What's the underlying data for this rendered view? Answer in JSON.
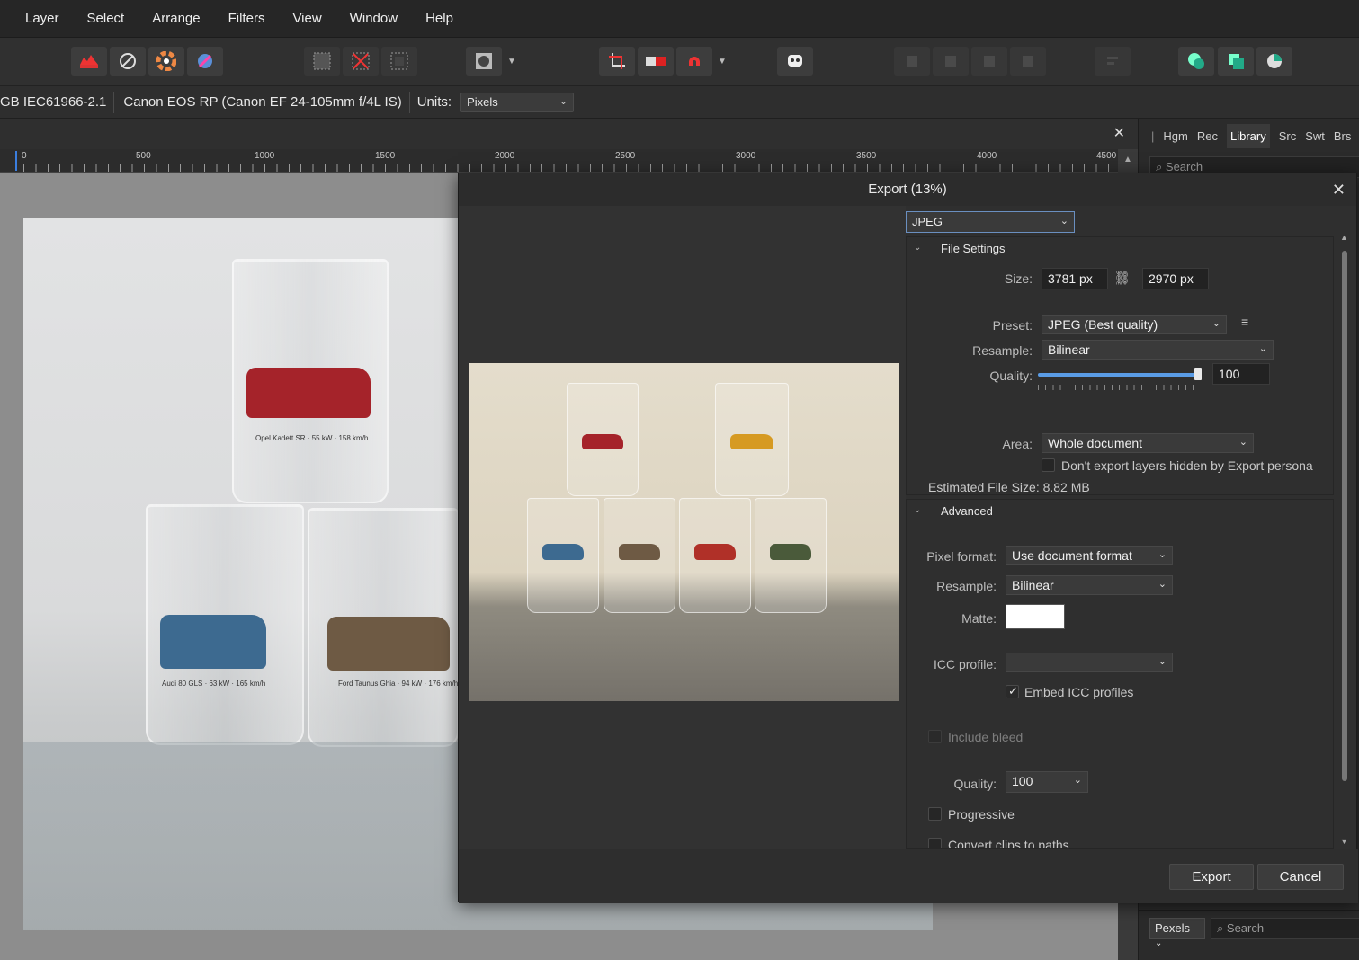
{
  "menu": [
    "Layer",
    "Select",
    "Arrange",
    "Filters",
    "View",
    "Window",
    "Help"
  ],
  "context_bar": {
    "color_profile": "GB IEC61966-2.1",
    "camera": "Canon EOS RP (Canon EF 24-105mm f/4L IS)",
    "units_label": "Units:",
    "units_value": "Pixels"
  },
  "ruler": {
    "labels": [
      "0",
      "500",
      "1000",
      "1500",
      "2000",
      "2500",
      "3000",
      "3500",
      "4000",
      "4500"
    ]
  },
  "document_image": {
    "labels": [
      "Opel Kadett SR · 55 kW · 158 km/h",
      "Audi 80 GLS · 63 kW · 165 km/h",
      "Ford Taunus Ghia · 94 kW · 176 km/h"
    ]
  },
  "right_panel": {
    "tabs": [
      "Hgm",
      "Rec",
      "Library",
      "Src",
      "Swt",
      "Brs"
    ],
    "active_tab": "Library",
    "search_placeholder": "Search",
    "bottom_source": "Pexels",
    "bottom_search_placeholder": "Search"
  },
  "export_dialog": {
    "title": "Export (13%)",
    "format": "JPEG",
    "file_settings": {
      "header": "File Settings",
      "size_label": "Size:",
      "width": "3781 px",
      "height": "2970 px",
      "preset_label": "Preset:",
      "preset_value": "JPEG (Best quality)",
      "resample_label": "Resample:",
      "resample_value": "Bilinear",
      "quality_label": "Quality:",
      "quality_value": "100",
      "quality_fraction": 1.0,
      "area_label": "Area:",
      "area_value": "Whole document",
      "hidden_layers_label": "Don't export layers hidden by Export persona",
      "estimated_size": "Estimated File Size: 8.82 MB"
    },
    "advanced": {
      "header": "Advanced",
      "pixel_format_label": "Pixel format:",
      "pixel_format_value": "Use document format",
      "resample_label": "Resample:",
      "resample_value": "Bilinear",
      "matte_label": "Matte:",
      "matte_color": "#ffffff",
      "icc_label": "ICC profile:",
      "icc_value": "",
      "embed_icc_label": "Embed ICC profiles",
      "include_bleed_label": "Include bleed",
      "quality_label": "Quality:",
      "quality_value": "100",
      "progressive_label": "Progressive",
      "convert_clips_label": "Convert clips to paths"
    },
    "export_button": "Export",
    "cancel_button": "Cancel"
  }
}
